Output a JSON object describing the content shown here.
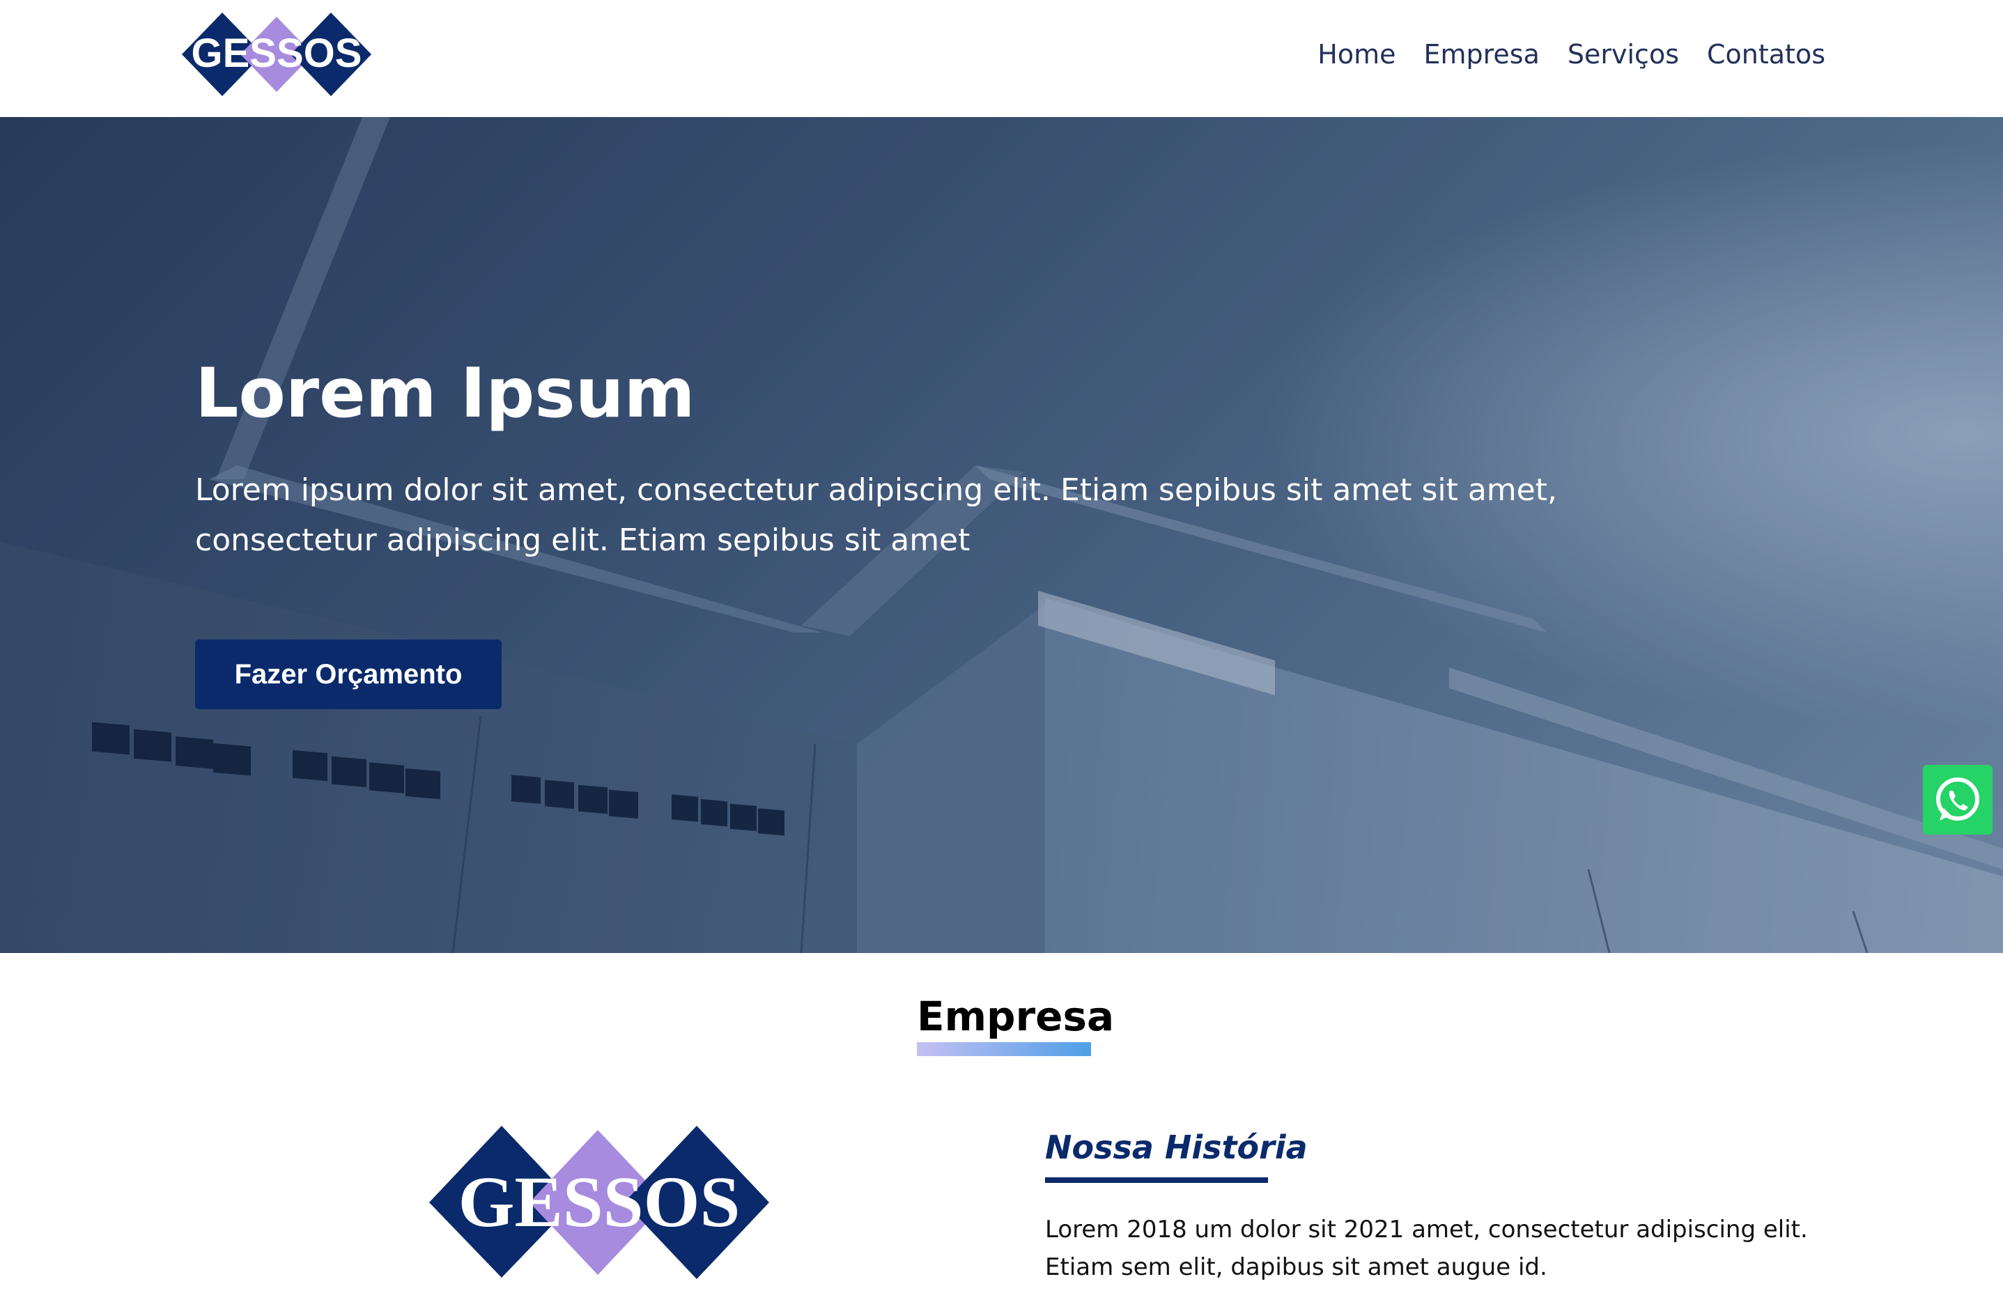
{
  "header": {
    "logo_text": "GESSOS",
    "nav": [
      {
        "label": "Home"
      },
      {
        "label": "Empresa"
      },
      {
        "label": "Serviços"
      },
      {
        "label": "Contatos"
      }
    ]
  },
  "hero": {
    "title": "Lorem Ipsum",
    "text": "Lorem ipsum dolor sit amet, consectetur adipiscing elit. Etiam sepibus sit amet sit amet, consectetur adipiscing elit. Etiam sepibus sit amet",
    "button_label": "Fazer Orçamento"
  },
  "floating": {
    "icon": "whatsapp-icon"
  },
  "empresa": {
    "title": "Empresa",
    "logo_text": "GESSOS",
    "history_title": "Nossa História",
    "history_text": "Lorem 2018 um dolor sit 2021 amet, consectetur adipiscing elit. Etiam sem elit, dapibus sit amet augue id."
  },
  "colors": {
    "brand_navy": "#0a2a6b",
    "brand_lavender": "#a78bdf",
    "whatsapp_green": "#25d366",
    "nav_text": "#23305a"
  }
}
